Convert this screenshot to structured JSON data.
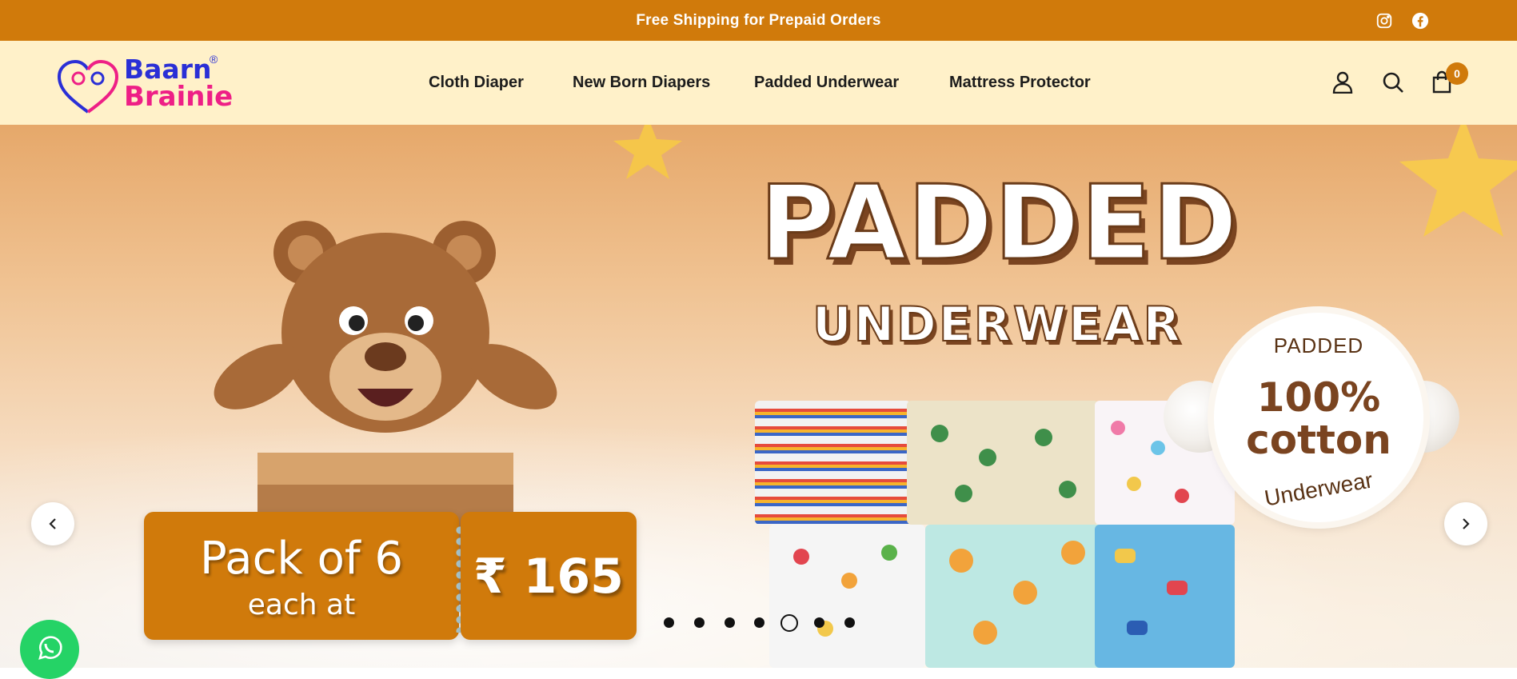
{
  "announcement": {
    "text": "Free Shipping for Prepaid Orders"
  },
  "social": [
    {
      "icon": "instagram-icon"
    },
    {
      "icon": "facebook-icon"
    }
  ],
  "logo": {
    "line1": "Baarn",
    "line2": "Brainie",
    "registered": "®"
  },
  "nav": {
    "items": [
      {
        "label": "Cloth Diaper"
      },
      {
        "label": "New Born Diapers"
      },
      {
        "label": "Padded Underwear"
      },
      {
        "label": "Mattress Protector"
      }
    ]
  },
  "header_icons": {
    "account": "account-icon",
    "search": "search-icon",
    "cart": "cart-icon",
    "cart_count": "0"
  },
  "hero": {
    "title": "PADDED",
    "subtitle": "UNDERWEAR",
    "badge": {
      "top": "PADDED",
      "mid1": "100%",
      "mid2": "cotton",
      "bottom": "Underwear"
    },
    "offer": {
      "line1": "Pack of 6",
      "line2": "each at",
      "price": "₹ 165"
    }
  },
  "slider": {
    "total": 7,
    "active_index": 4
  },
  "colors": {
    "brand_orange": "#d07a0b",
    "header_bg": "#fff1c9",
    "logo_blue": "#2a2fd6",
    "logo_pink": "#ee1f86",
    "whatsapp": "#25d366"
  }
}
